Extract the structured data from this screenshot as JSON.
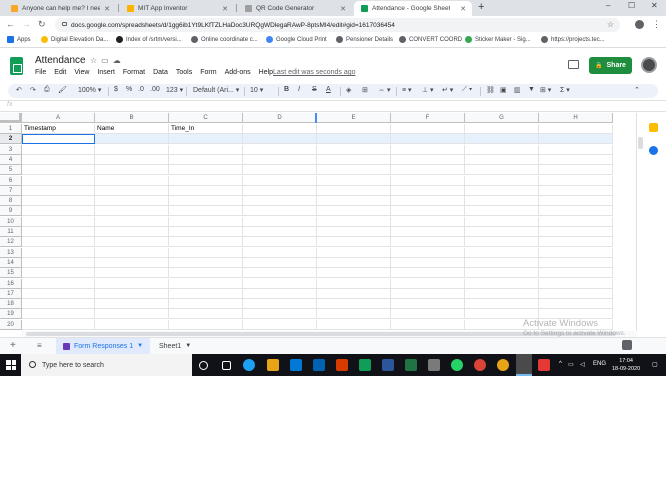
{
  "browser": {
    "tabs": [
      {
        "title": "Anyone can help me? I need Yo..."
      },
      {
        "title": "MIT App Inventor"
      },
      {
        "title": "QR Code Generator"
      },
      {
        "title": "Attendance - Google Sheets"
      }
    ],
    "new_tab": "+",
    "window_controls": [
      "–",
      "☐",
      "✕"
    ],
    "url": "docs.google.com/spreadsheets/d/1gg6ib1Yt9LKfTZLHaDoc3URQgWDlegaRAwP-8ptsMI4/edit#gid=1617036454",
    "bookmarks": [
      "Apps",
      "Digital Elevation Da...",
      "Index of /srtm/versi...",
      "Online coordinate c...",
      "Google Cloud Print",
      "Pensioner Details",
      "CONVERT COORD",
      "Sticker Maker - Sig...",
      "https://projects.tec..."
    ]
  },
  "sheets": {
    "doc_title": "Attendance",
    "menu": [
      "File",
      "Edit",
      "View",
      "Insert",
      "Format",
      "Data",
      "Tools",
      "Form",
      "Add-ons",
      "Help"
    ],
    "last_edit": "Last edit was seconds ago",
    "share_label": "Share",
    "toolbar": {
      "zoom": "100%",
      "currency": "$",
      "percent": "%",
      "decimal_less": ".0",
      "decimal_more": ".00",
      "more_formats": "123",
      "font": "Default (Ari...",
      "font_size": "10",
      "bold": "B",
      "italic": "I",
      "strike": "S",
      "text_color": "A"
    },
    "formula_label": "fx",
    "columns": [
      "A",
      "B",
      "C",
      "D",
      "E",
      "F",
      "G",
      "H"
    ],
    "rows": [
      "1",
      "2",
      "3",
      "4",
      "5",
      "6",
      "7",
      "8",
      "9",
      "10",
      "11",
      "12",
      "13",
      "14",
      "15",
      "16",
      "17",
      "18",
      "19",
      "20"
    ],
    "header_row": [
      "Timestamp",
      "Name",
      "Time_In",
      "",
      "",
      "",
      "",
      ""
    ],
    "sheet_tabs": [
      "Form Responses 1",
      "Sheet1"
    ],
    "watermark_title": "Activate Windows",
    "watermark_sub": "Go to Settings to activate Windows."
  },
  "taskbar": {
    "search_placeholder": "Type here to search",
    "language": "ENG",
    "time": "17:04",
    "date": "18-09-2020"
  },
  "colors": {
    "sheets_green": "#0f9d58",
    "share_green": "#1e8e3e",
    "selection_blue": "#1a73e8",
    "taskbar": "#111217"
  }
}
